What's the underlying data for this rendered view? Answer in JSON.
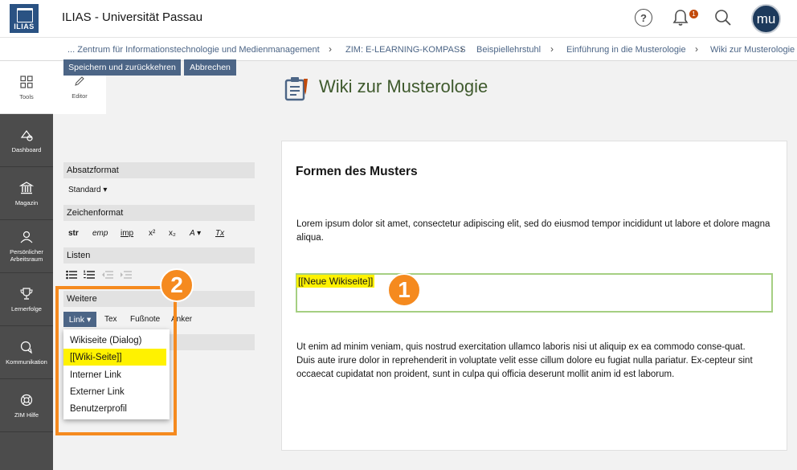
{
  "header": {
    "logo_text": "ILIAS",
    "title": "ILIAS - Universität Passau",
    "help_icon": "?",
    "notification_count": "1",
    "avatar_initials": "mu"
  },
  "breadcrumb": [
    "... Zentrum für Informationstechnologie und Medienmanagement",
    "ZIM: E-LEARNING-KOMPASS",
    "Beispiellehrstuhl",
    "Einführung in die Musterologie",
    "Wiki zur Musterologie"
  ],
  "mainbar": {
    "items": [
      {
        "label": "Tools",
        "icon": "grid-icon"
      },
      {
        "label": "Dashboard",
        "icon": "dashboard-icon"
      },
      {
        "label": "Magazin",
        "icon": "library-icon"
      },
      {
        "label": "Persönlicher Arbeitsraum",
        "icon": "person-icon"
      },
      {
        "label": "Lernerfolge",
        "icon": "trophy-icon"
      },
      {
        "label": "Kommunikation",
        "icon": "chat-icon"
      },
      {
        "label": "ZIM Hilfe",
        "icon": "lifebuoy-icon"
      }
    ]
  },
  "slate": {
    "tab_label": "Editor",
    "save_button": "Speichern und zurückkehren",
    "cancel_button": "Abbrechen",
    "paragraph_header": "Absatzformat",
    "paragraph_value": "Standard",
    "char_header": "Zeichenformat",
    "char_formats": [
      "str",
      "emp",
      "imp",
      "x²",
      "x₂",
      "A",
      "Tx"
    ],
    "lists_header": "Listen",
    "more_header": "Weitere",
    "link_button": "Link",
    "more_options": [
      "Tex",
      "Fußnote",
      "Anker"
    ],
    "link_menu": [
      "Wikiseite (Dialog)",
      "[[Wiki-Seite]]",
      "Interner Link",
      "Externer Link",
      "Benutzerprofil"
    ]
  },
  "annotations": {
    "marker_1": "1",
    "marker_2": "2"
  },
  "content": {
    "page_title": "Wiki zur Musterologie",
    "heading": "Formen des Musters",
    "para1": "Lorem ipsum dolor sit amet, consectetur adipiscing elit, sed do eiusmod tempor incididunt ut labore et dolore magna aliqua.",
    "link_text": "[[Neue Wikiseite]]",
    "para2": "Ut enim ad minim veniam, quis nostrud exercitation ullamco laboris nisi ut aliquip ex ea commodo conse-quat. Duis aute irure dolor in reprehenderit in voluptate velit esse cillum dolore eu fugiat nulla pariatur. Ex-cepteur sint occaecat cupidatat non proident, sunt in culpa qui officia deserunt mollit anim id est laborum."
  },
  "colors": {
    "primary": "#4c6586",
    "mainbar": "#4c4c4c",
    "highlight": "#fff200",
    "annotation": "#f58a1f",
    "title_green": "#3f5a2d"
  }
}
